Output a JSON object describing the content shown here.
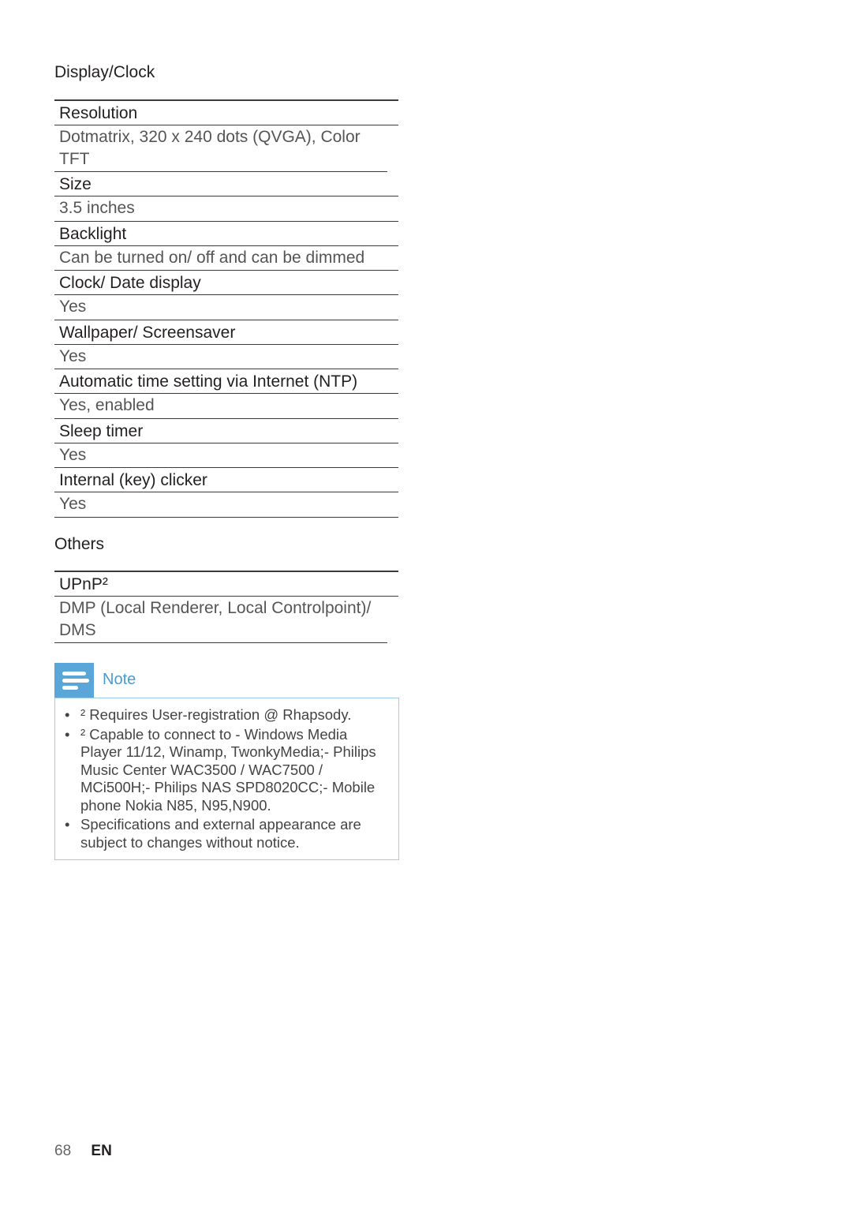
{
  "sections": {
    "display_clock": {
      "title": "Display/Clock",
      "rows": [
        {
          "label": "Resolution",
          "value": "Dotmatrix, 320 x 240 dots (QVGA), Color TFT"
        },
        {
          "label": "Size",
          "value": "3.5 inches"
        },
        {
          "label": "Backlight",
          "value": "Can be turned on/ off and can be dimmed"
        },
        {
          "label": "Clock/ Date display",
          "value": "Yes"
        },
        {
          "label": "Wallpaper/ Screensaver",
          "value": "Yes"
        },
        {
          "label": "Automatic time setting via Internet (NTP)",
          "value": "Yes, enabled"
        },
        {
          "label": "Sleep timer",
          "value": "Yes"
        },
        {
          "label": "Internal (key) clicker",
          "value": "Yes"
        }
      ]
    },
    "others": {
      "title": "Others",
      "rows": [
        {
          "label": "UPnP²",
          "value": "DMP (Local Renderer, Local Controlpoint)/ DMS"
        }
      ]
    }
  },
  "note": {
    "title": "Note",
    "icon": "note-lines-icon",
    "accent_color": "#5aa6d8",
    "items": [
      "² Requires User-registration @ Rhapsody.",
      "² Capable to connect to - Windows Media Player 11/12, Winamp, TwonkyMedia;- Philips Music Center WAC3500 / WAC7500 / MCi500H;- Philips NAS SPD8020CC;- Mobile phone Nokia N85, N95,N900.",
      "Specifications and external appearance are subject to changes without notice."
    ],
    "bullet": "•"
  },
  "footer": {
    "page_number": "68",
    "language": "EN"
  }
}
